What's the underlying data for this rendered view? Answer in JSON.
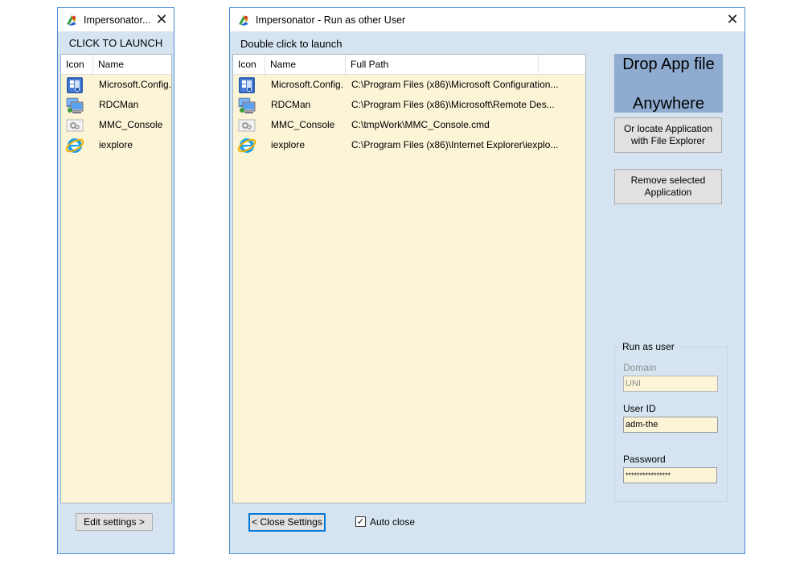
{
  "small_window": {
    "title": "Impersonator...",
    "close_glyph": "✕",
    "heading": "CLICK TO LAUNCH",
    "columns": [
      "Icon",
      "Name"
    ],
    "rows": [
      {
        "icon": "config-manager-icon",
        "name": "Microsoft.Config..."
      },
      {
        "icon": "rdcman-icon",
        "name": "RDCMan"
      },
      {
        "icon": "mmc-console-icon",
        "name": "MMC_Console"
      },
      {
        "icon": "internet-explorer-icon",
        "name": "iexplore"
      }
    ],
    "edit_settings_label": "Edit settings >"
  },
  "main_window": {
    "title": "Impersonator - Run as other User",
    "close_glyph": "✕",
    "heading": "Double click to launch",
    "columns": [
      "Icon",
      "Name",
      "Full Path"
    ],
    "rows": [
      {
        "icon": "config-manager-icon",
        "name": "Microsoft.Config...",
        "path": "C:\\Program Files (x86)\\Microsoft Configuration..."
      },
      {
        "icon": "rdcman-icon",
        "name": "RDCMan",
        "path": "C:\\Program Files (x86)\\Microsoft\\Remote Des..."
      },
      {
        "icon": "mmc-console-icon",
        "name": "MMC_Console",
        "path": "C:\\tmpWork\\MMC_Console.cmd"
      },
      {
        "icon": "internet-explorer-icon",
        "name": "iexplore",
        "path": "C:\\Program Files (x86)\\Internet Explorer\\iexplo..."
      }
    ],
    "drop_zone": {
      "line1": "Drop App file",
      "line2": "Anywhere"
    },
    "locate_button": {
      "line1": "Or locate Application",
      "line2": "with File Explorer"
    },
    "remove_button": {
      "line1": "Remove selected",
      "line2": "Application"
    },
    "run_as": {
      "title": "Run as user",
      "domain_label": "Domain",
      "domain_value": "UNI",
      "userid_label": "User ID",
      "userid_value": "adm-the",
      "password_label": "Password",
      "password_value": "****************"
    },
    "close_settings_label": "< Close Settings",
    "auto_close_label": "Auto close",
    "auto_close_checked": true
  },
  "colors": {
    "window_bg": "#d6e4f2",
    "window_border": "#4a8fd4",
    "list_bg": "#fbf4d6",
    "drop_zone_bg": "#8fabd0",
    "focus_border": "#0078d7"
  }
}
